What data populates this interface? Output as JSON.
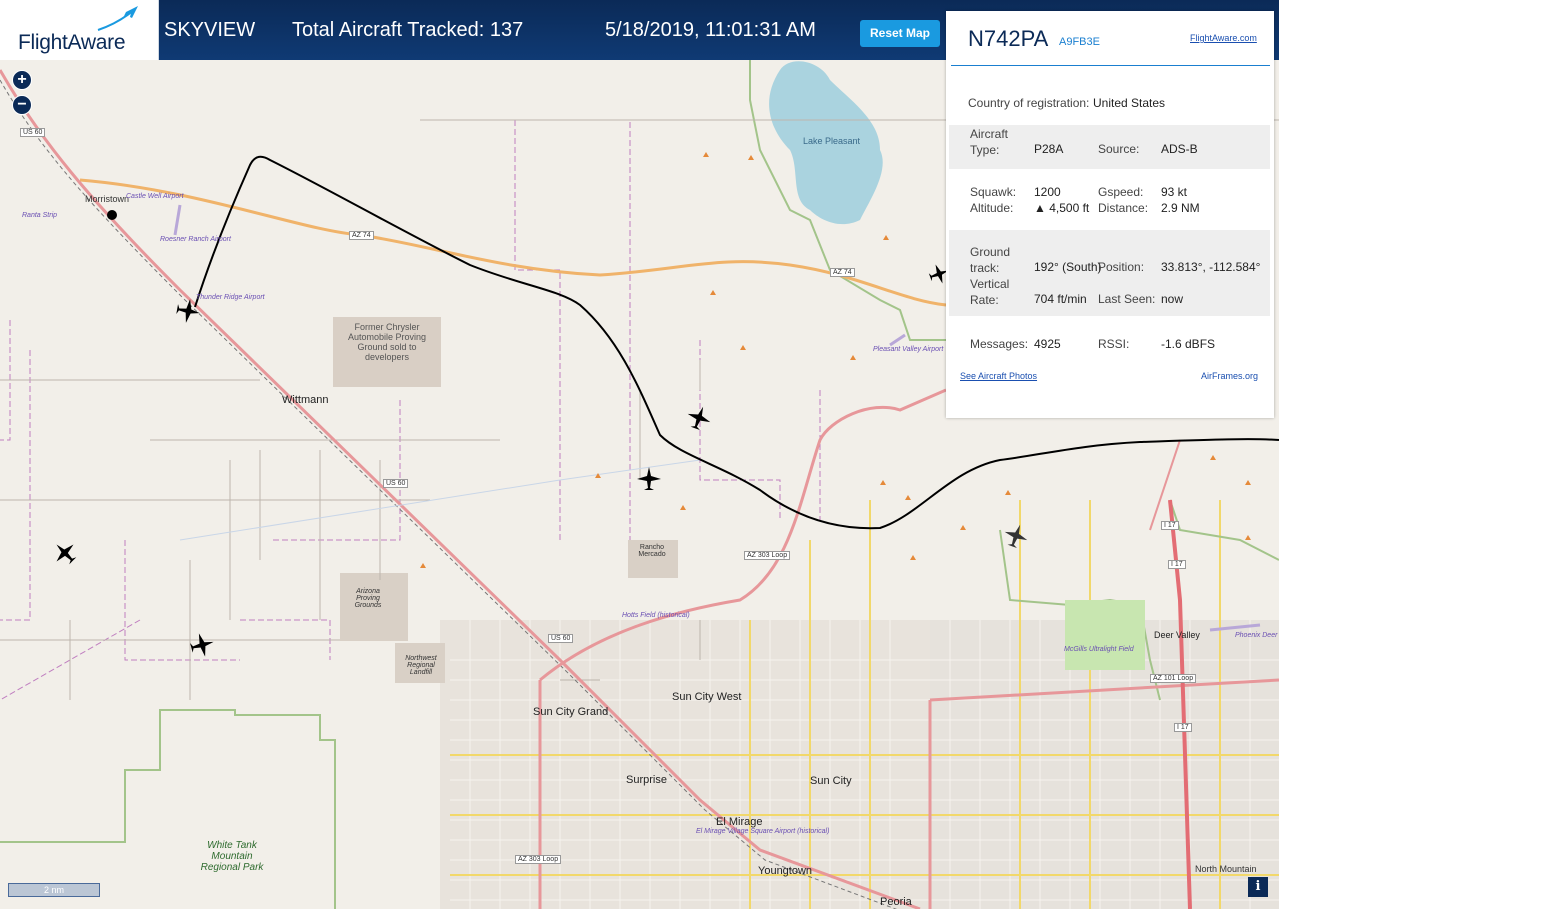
{
  "header": {
    "logo_text": "FlightAware",
    "app_name": "SKYVIEW",
    "total_tracked": "Total Aircraft Tracked: 137",
    "datetime": "5/18/2019, 11:01:31 AM",
    "reset_label": "Reset Map"
  },
  "map": {
    "zoom_in": "+",
    "zoom_out": "−",
    "scale_label": "2 nm",
    "info_label": "i",
    "labels": {
      "morristown": "Morristown",
      "wittmann": "Wittmann",
      "castle_well": "Castle Well Airport",
      "roesner": "Roesner Ranch Airport",
      "thunder_ridge": "Thunder Ridge Airport",
      "ranta": "Ranta Strip",
      "chrysler": "Former Chrysler Automobile Proving Ground sold to developers",
      "lake_pleasant": "Lake Pleasant",
      "pleasant_valley": "Pleasant Valley Airport",
      "rancho_mercado": "Rancho Mercado",
      "az_proving": "Arizona Proving Grounds",
      "nw_landfill": "Northwest Regional Landfill",
      "hotts": "Hotts Field (historical)",
      "sun_city_grand": "Sun City Grand",
      "sun_city_west": "Sun City West",
      "surprise": "Surprise",
      "sun_city": "Sun City",
      "el_mirage": "El Mirage",
      "el_mirage_apt": "El Mirage Village Square Airport (historical)",
      "youngtown": "Youngtown",
      "peoria": "Peoria",
      "white_tank": "White Tank Mountain Regional Park",
      "deer_valley": "Deer Valley",
      "phoenix_dv": "Phoenix Deer Valley Airport",
      "mcgills": "McGills Ultralight Field",
      "north_mountain": "North Mountain",
      "us60_a": "US 60",
      "us60_b": "US 60",
      "us60_c": "US 60",
      "az74_a": "AZ 74",
      "az74_b": "AZ 74",
      "az303_a": "AZ 303 Loop",
      "az303_b": "AZ 303 Loop",
      "az101": "AZ 101 Loop",
      "i17_a": "I 17",
      "i17_b": "I 17",
      "i17_c": "I 17"
    }
  },
  "panel": {
    "registration": "N742PA",
    "hex": "A9FB3E",
    "fa_link": "FlightAware.com",
    "country_label": "Country of registration:",
    "country_value": "United States",
    "aircraft_type_label": "Aircraft Type:",
    "aircraft_type_value": "P28A",
    "source_label": "Source:",
    "source_value": "ADS-B",
    "squawk_label": "Squawk:",
    "squawk_value": "1200",
    "gspeed_label": "Gspeed:",
    "gspeed_value": "93 kt",
    "altitude_label": "Altitude:",
    "altitude_value": "▲ 4,500 ft",
    "distance_label": "Distance:",
    "distance_value": "2.9 NM",
    "ground_track_label": "Ground track:",
    "ground_track_value": "192° (South)",
    "position_label": "Position:",
    "position_value": "33.813°, -112.584°",
    "vertical_rate_label": "Vertical Rate:",
    "vertical_rate_value": "704 ft/min",
    "last_seen_label": "Last Seen:",
    "last_seen_value": "now",
    "messages_label": "Messages:",
    "messages_value": "4925",
    "rssi_label": "RSSI:",
    "rssi_value": "-1.6 dBFS",
    "photos_link": "See Aircraft Photos",
    "airframes_link": "AirFrames.org"
  },
  "colors": {
    "header_bg": "#0f3a74",
    "accent": "#1a9ae0",
    "map_bg": "#f2efe9",
    "track": "#000000"
  }
}
